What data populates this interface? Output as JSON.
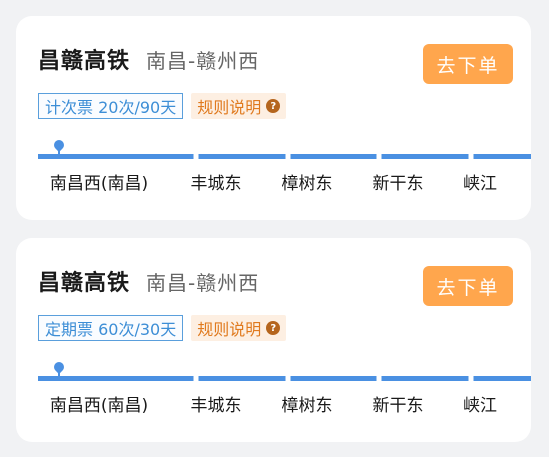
{
  "cards": [
    {
      "line_name": "昌赣高铁",
      "route": "南昌-赣州西",
      "ticket_type": "计次票 20次/90天",
      "rules_label": "规则说明",
      "rules_icon": "question-circle-icon",
      "order_label": "去下单",
      "stations": [
        "南昌西(南昌)",
        "丰城东",
        "樟树东",
        "新干东",
        "峡江"
      ]
    },
    {
      "line_name": "昌赣高铁",
      "route": "南昌-赣州西",
      "ticket_type": "定期票 60次/30天",
      "rules_label": "规则说明",
      "rules_icon": "question-circle-icon",
      "order_label": "去下单",
      "stations": [
        "南昌西(南昌)",
        "丰城东",
        "樟树东",
        "新干东",
        "峡江"
      ]
    }
  ],
  "colors": {
    "accent_blue": "#4a90e2",
    "order_button": "#ffa64d",
    "rules_text": "#e07a1e"
  }
}
